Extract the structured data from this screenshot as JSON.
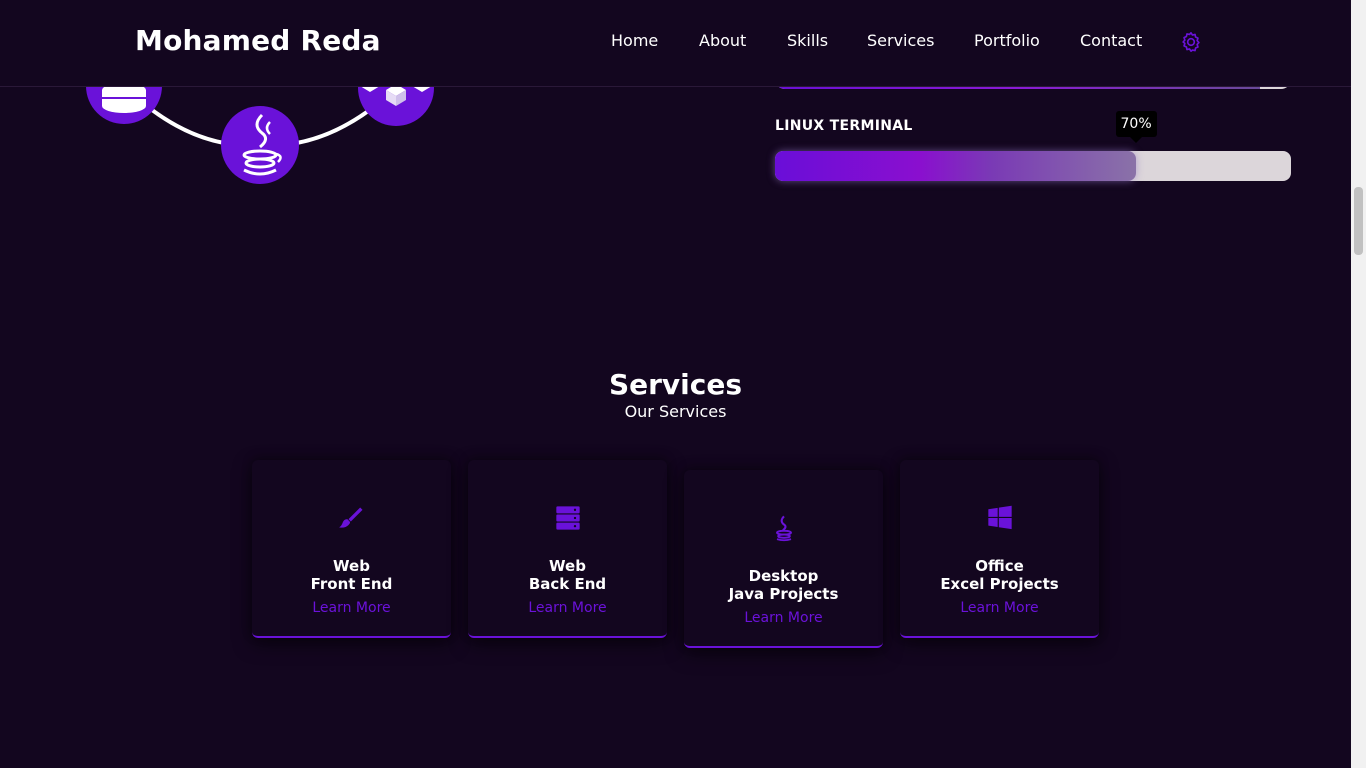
{
  "header": {
    "logo": "Mohamed Reda",
    "nav": [
      {
        "label": "Home"
      },
      {
        "label": "About"
      },
      {
        "label": "Skills"
      },
      {
        "label": "Services"
      },
      {
        "label": "Portfolio"
      },
      {
        "label": "Contact"
      }
    ],
    "settings_icon": "gear-icon"
  },
  "colors": {
    "background": "#13061f",
    "accent": "#6a12d9",
    "text": "#ffffff",
    "track": "#dcd6da"
  },
  "skills": {
    "diagram_icons": [
      "database-icon",
      "java-icon",
      "box-icon"
    ],
    "items": [
      {
        "label": "LINUX TERMINAL",
        "percent_label": "70%",
        "percent": 70
      }
    ]
  },
  "services": {
    "title": "Services",
    "subtitle": "Our Services",
    "cards": [
      {
        "icon": "brush-icon",
        "line1": "Web",
        "line2": "Front End",
        "link": "Learn More"
      },
      {
        "icon": "server-icon",
        "line1": "Web",
        "line2": "Back End",
        "link": "Learn More"
      },
      {
        "icon": "java-icon",
        "line1": "Desktop",
        "line2": "Java Projects",
        "link": "Learn More"
      },
      {
        "icon": "windows-icon",
        "line1": "Office",
        "line2": "Excel Projects",
        "link": "Learn More"
      }
    ]
  }
}
